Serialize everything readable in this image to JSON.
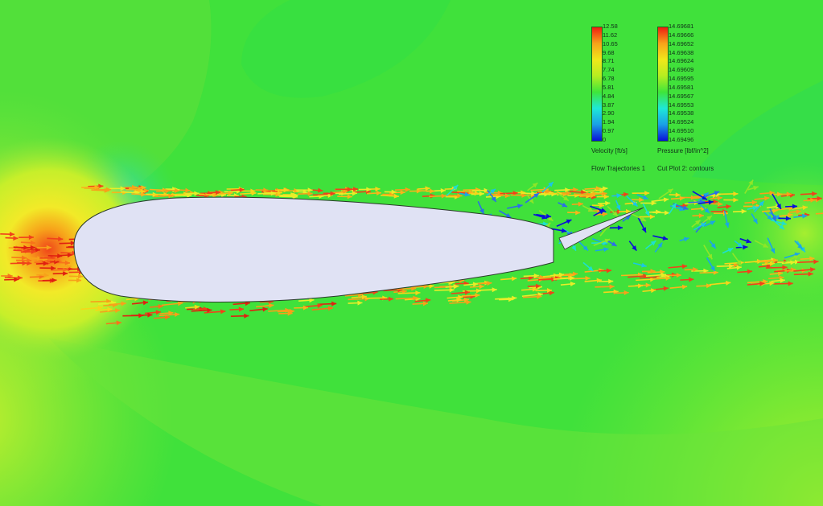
{
  "scene": {
    "description_tags": [
      "airfoil",
      "flap",
      "flow-arrows",
      "pressure-contours"
    ],
    "background_color": "#3fe23a",
    "airfoil_fill": "#e0e2f4"
  },
  "velocity_legend": {
    "ticks": [
      "12.58",
      "11.62",
      "10.65",
      "9.68",
      "8.71",
      "7.74",
      "6.78",
      "5.81",
      "4.84",
      "3.87",
      "2.90",
      "1.94",
      "0.97",
      "0"
    ],
    "title": "Velocity [ft/s]",
    "subtitle": "Flow Trajectories 1"
  },
  "pressure_legend": {
    "ticks": [
      "14.69681",
      "14.69666",
      "14.69652",
      "14.69638",
      "14.69624",
      "14.69609",
      "14.69595",
      "14.69581",
      "14.69567",
      "14.69553",
      "14.69538",
      "14.69524",
      "14.69510",
      "14.69496"
    ],
    "title": "Pressure [lbf/in^2]",
    "subtitle": "Cut Plot 2: contours"
  },
  "colormap": [
    "#0a10d8",
    "#1aa0e6",
    "#1ee8d8",
    "#3ee63a",
    "#b4ee20",
    "#f0e81a",
    "#f7a41a",
    "#f01e12"
  ]
}
